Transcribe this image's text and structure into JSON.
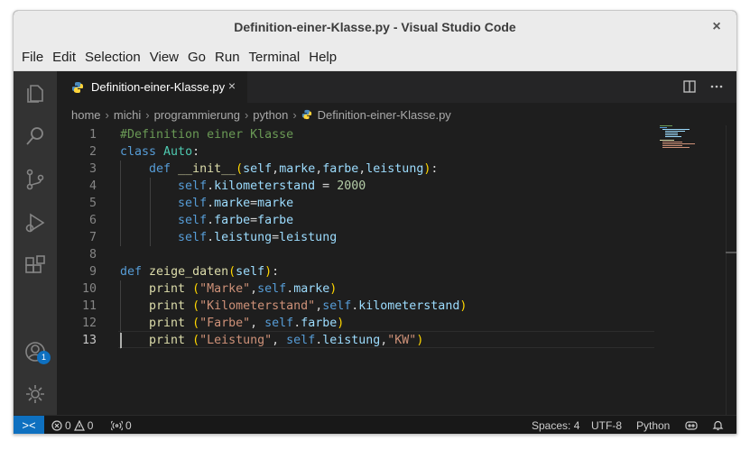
{
  "window": {
    "title": "Definition-einer-Klasse.py - Visual Studio Code"
  },
  "menu": [
    "File",
    "Edit",
    "Selection",
    "View",
    "Go",
    "Run",
    "Terminal",
    "Help"
  ],
  "activity": {
    "items": [
      "explorer-icon",
      "search-icon",
      "source-control-icon",
      "run-debug-icon",
      "extensions-icon",
      "account-icon",
      "settings-gear-icon"
    ],
    "account_badge": "1"
  },
  "tab": {
    "label": "Definition-einer-Klasse.py",
    "close": "×"
  },
  "tab_actions": {
    "split": "split-editor-icon",
    "more": "more-actions-icon"
  },
  "breadcrumb": [
    "home",
    "michi",
    "programmierung",
    "python",
    "Definition-einer-Klasse.py"
  ],
  "editor": {
    "line_numbers": [
      "1",
      "2",
      "3",
      "4",
      "5",
      "6",
      "7",
      "8",
      "9",
      "10",
      "11",
      "12",
      "13"
    ],
    "active_line": "13"
  },
  "status": {
    "errors": "0",
    "warnings": "0",
    "ports": "0",
    "spaces": "Spaces: 4",
    "encoding": "UTF-8",
    "language": "Python"
  },
  "colors": {
    "accent": "#0e70c0",
    "editor_bg": "#1e1e1e",
    "keyword": "#569cd6",
    "string": "#ce9178",
    "comment": "#6a9955",
    "function": "#dcdcaa",
    "class": "#4ec9b0"
  }
}
